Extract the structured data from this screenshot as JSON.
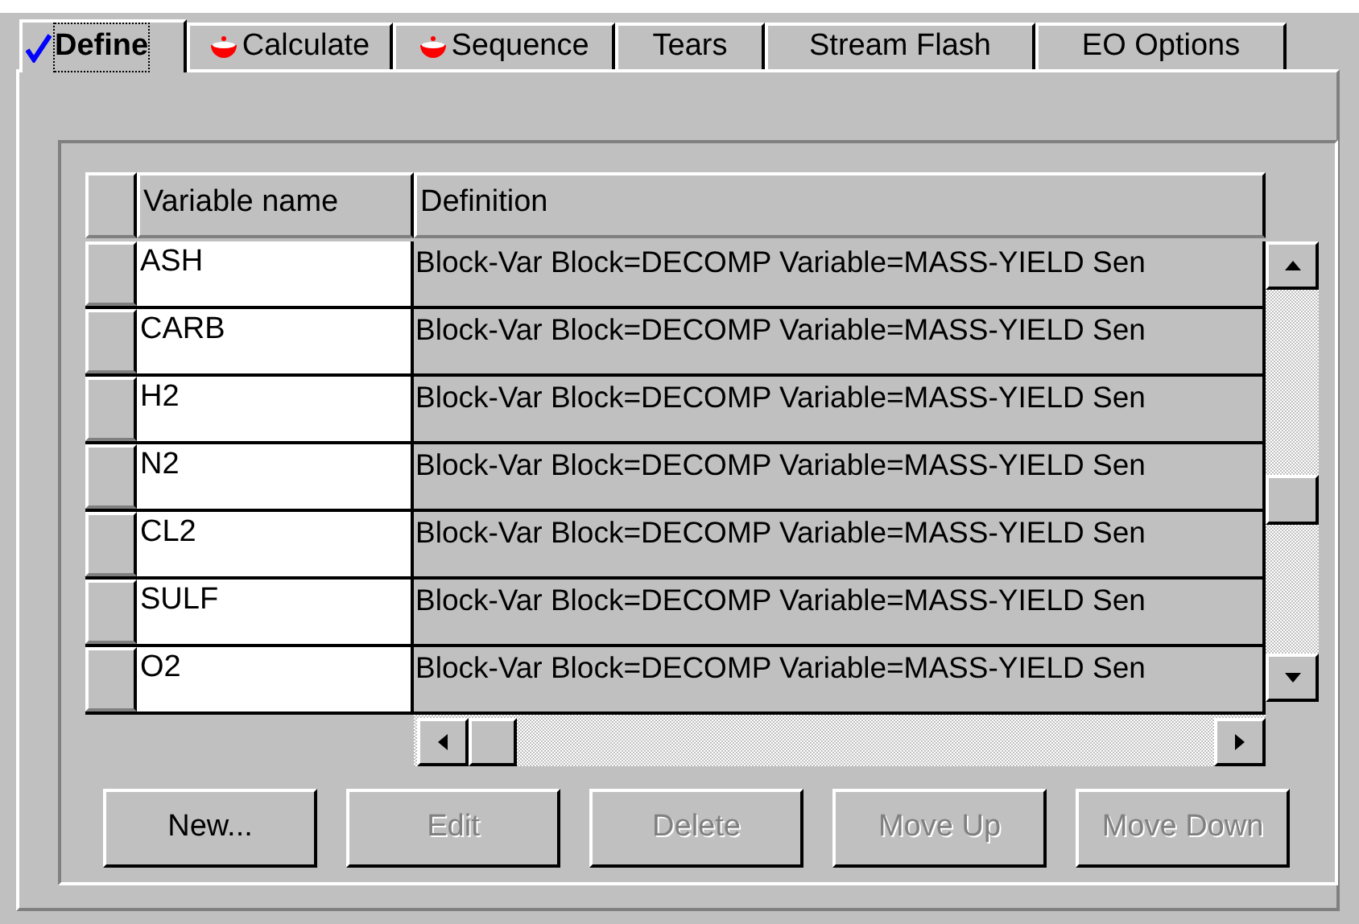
{
  "tabs": [
    {
      "label": "Define",
      "selected": true,
      "kind": "complete"
    },
    {
      "label": "Calculate",
      "selected": false,
      "kind": "incomplete"
    },
    {
      "label": "Sequence",
      "selected": false,
      "kind": "incomplete"
    },
    {
      "label": "Tears",
      "selected": false,
      "kind": "plain"
    },
    {
      "label": "Stream Flash",
      "selected": false,
      "kind": "plain"
    },
    {
      "label": "EO Options",
      "selected": false,
      "kind": "plain"
    }
  ],
  "table": {
    "columns": [
      "Variable name",
      "Definition"
    ],
    "rows": [
      {
        "variable_name": "ASH",
        "definition": "Block-Var Block=DECOMP Variable=MASS-YIELD Sen"
      },
      {
        "variable_name": "CARB",
        "definition": "Block-Var Block=DECOMP Variable=MASS-YIELD Sen"
      },
      {
        "variable_name": "H2",
        "definition": "Block-Var Block=DECOMP Variable=MASS-YIELD Sen"
      },
      {
        "variable_name": "N2",
        "definition": "Block-Var Block=DECOMP Variable=MASS-YIELD Sen"
      },
      {
        "variable_name": "CL2",
        "definition": "Block-Var Block=DECOMP Variable=MASS-YIELD Sen"
      },
      {
        "variable_name": "SULF",
        "definition": "Block-Var Block=DECOMP Variable=MASS-YIELD Sen"
      },
      {
        "variable_name": "O2",
        "definition": "Block-Var Block=DECOMP Variable=MASS-YIELD Sen"
      }
    ]
  },
  "buttons": [
    {
      "label": "New...",
      "disabled": false
    },
    {
      "label": "Edit",
      "disabled": true
    },
    {
      "label": "Delete",
      "disabled": true
    },
    {
      "label": "Move Up",
      "disabled": true
    },
    {
      "label": "Move Down",
      "disabled": true
    }
  ]
}
